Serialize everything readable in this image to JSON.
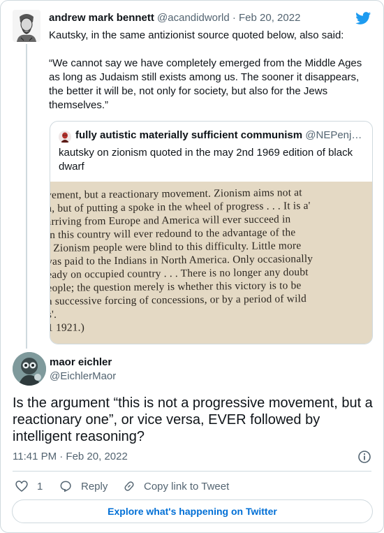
{
  "embedded_tweet": {
    "author_name": "andrew mark bennett",
    "author_handle": "@acandidworld",
    "separator": "·",
    "date": "Feb 20, 2022",
    "paragraphs": [
      "Kautsky, in the same antizionist source quoted below, also said:",
      "“We cannot say we have completely emerged from the Middle Ages as long as Judaism still exists among us. The sooner it disappears, the better it will be, not only for society, but also for the Jews themselves.”"
    ],
    "quoted_tweet": {
      "author_name": "fully autistic materially sufficient communism",
      "author_handle": "@NEPenj…",
      "text": "kautsky on zionism quoted in the may 2nd 1969 edition of black dwarf",
      "image_lines": [
        "vement, but a reactionary movement. Zionism aims not at",
        "n, but of putting a spoke in the wheel of progress . . . It is a'",
        "arriving from Europe and America will ever succeed in",
        " in this country will ever redound to the advantage of the",
        "f Zionism people were blind to this difficulty. Little more",
        "vas paid to the Indians in North America. Only occasionally",
        "eady on occupied country . . . There is no longer any doubt",
        "eople; the question merely is whether this victory is to be",
        "a successive forcing of concessions, or by a period of wild",
        "s'.",
        "1 1921.)"
      ]
    }
  },
  "reply_tweet": {
    "author_name": "maor eichler",
    "author_handle": "@EichlerMaor",
    "text": "Is the argument “this is not a progressive movement, but a reactionary one”, or vice versa, EVER followed by intelligent reasoning?",
    "time": "11:41 PM · Feb 20, 2022"
  },
  "actions": {
    "like_count": "1",
    "reply_label": "Reply",
    "copy_link_label": "Copy link to Tweet"
  },
  "explore_label": "Explore what's happening on Twitter",
  "icons": {
    "brand": "twitter-bird-icon",
    "info": "info-icon",
    "like": "heart-icon",
    "reply": "reply-bubble-icon",
    "copy_link": "link-icon"
  },
  "colors": {
    "twitter_blue": "#1d9bf0",
    "link_blue": "#006fd6",
    "secondary_text": "#536471",
    "border": "#cfd9de"
  }
}
